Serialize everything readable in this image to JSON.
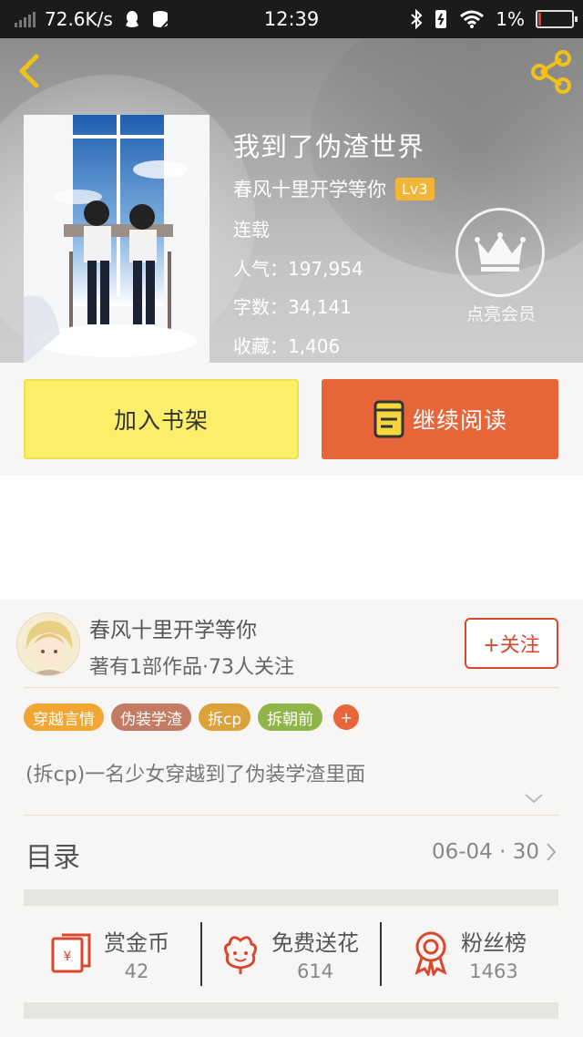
{
  "status_bar": {
    "net_speed": "72.6K/s",
    "time": "12:39",
    "battery": "1%",
    "battery_level": 0.01,
    "icons": [
      "signal-icon",
      "qq-icon",
      "data-icon",
      "bluetooth-icon",
      "vibrate-icon",
      "wifi-icon",
      "battery-icon"
    ]
  },
  "nav": {
    "back_icon": "chevron-left-icon",
    "share_icon": "share-icon"
  },
  "book": {
    "title": "我到了伪渣世界",
    "author": "春风十里开学等你",
    "level": "Lv3",
    "status": "连载",
    "popularity_label": "人气：",
    "popularity": "197,954",
    "words_label": "字数：",
    "words": "34,141",
    "favorites_label": "收藏：",
    "favorites": "1,406"
  },
  "vip": {
    "label": "点亮会员",
    "icon": "crown-icon"
  },
  "actions": {
    "add_shelf": "加入书架",
    "continue_read": "继续阅读",
    "read_icon": "book-icon"
  },
  "author_card": {
    "name": "春风十里开学等你",
    "works_info": "著有1部作品·73人关注",
    "follow": "+关注"
  },
  "tags": [
    {
      "label": "穿越言情",
      "color": "#f1a533"
    },
    {
      "label": "伪装学渣",
      "color": "#c57a63"
    },
    {
      "label": "拆cp",
      "color": "#dba13a"
    },
    {
      "label": "拆朝前",
      "color": "#8fb54a"
    }
  ],
  "tag_more": "+",
  "description": "(拆cp)一名少女穿越到了伪装学渣里面",
  "toc": {
    "label": "目录",
    "update": "06-04 · 30"
  },
  "stats": [
    {
      "name": "赏金币",
      "value": "42",
      "icon": "red-envelope-icon"
    },
    {
      "name": "免费送花",
      "value": "614",
      "icon": "flower-icon"
    },
    {
      "name": "粉丝榜",
      "value": "1463",
      "icon": "medal-icon"
    }
  ],
  "colors": {
    "accent": "#e8653a",
    "shelf_button": "#fbef6a",
    "follow": "#d9472e",
    "icon_gold": "#f0c11a"
  }
}
